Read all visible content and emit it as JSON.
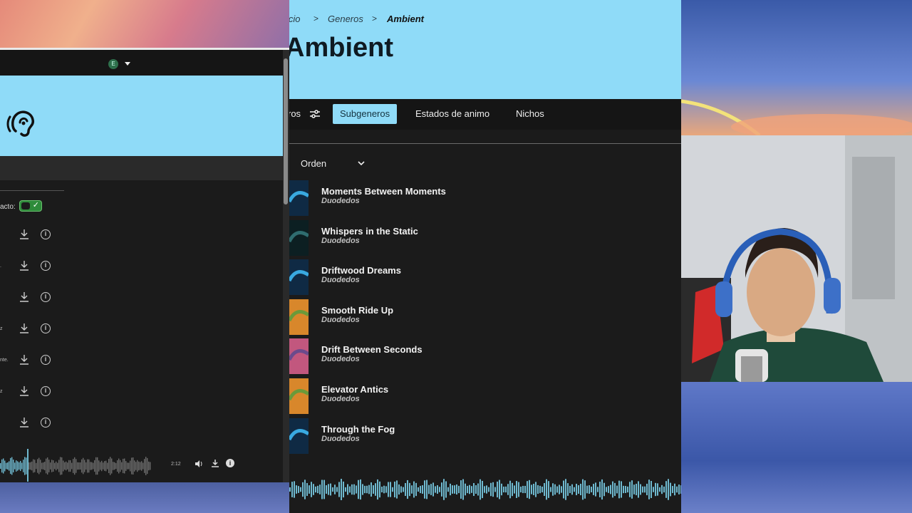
{
  "left_window": {
    "account_initial": "E",
    "contact_label": "acto:",
    "rows": [
      {
        "fragment": ""
      },
      {
        "fragment": "."
      },
      {
        "fragment": ""
      },
      {
        "fragment": "z"
      },
      {
        "fragment": "nte."
      },
      {
        "fragment": "z"
      },
      {
        "fragment": ""
      }
    ],
    "player_time": "2:12",
    "info_glyph": "i"
  },
  "center_window": {
    "breadcrumb": {
      "first": "icio",
      "second": "Generos",
      "current": "Ambient",
      "separator": ">"
    },
    "title": "Ambient",
    "tabs": {
      "filters_fragment": "ros",
      "subgeneros": "Subgeneros",
      "estados": "Estados de animo",
      "nichos": "Nichos"
    },
    "sort_label": "Orden",
    "tracks": [
      {
        "title": "Moments Between Moments",
        "artist": "Duodedos",
        "art": "blue-wave"
      },
      {
        "title": "Whispers in the Static",
        "artist": "Duodedos",
        "art": "teal-dark"
      },
      {
        "title": "Driftwood Dreams",
        "artist": "Duodedos",
        "art": "blue-wave"
      },
      {
        "title": "Smooth Ride Up",
        "artist": "Duodedos",
        "art": "orange-green"
      },
      {
        "title": "Drift Between Seconds",
        "artist": "Duodedos",
        "art": "pink-purple"
      },
      {
        "title": "Elevator Antics",
        "artist": "Duodedos",
        "art": "orange-green"
      },
      {
        "title": "Through the Fog",
        "artist": "Duodedos",
        "art": "blue-wave"
      }
    ],
    "colors": {
      "accent": "#8fdbf8",
      "background": "#1b1b1b",
      "waveform": "#6fb9cf"
    }
  }
}
